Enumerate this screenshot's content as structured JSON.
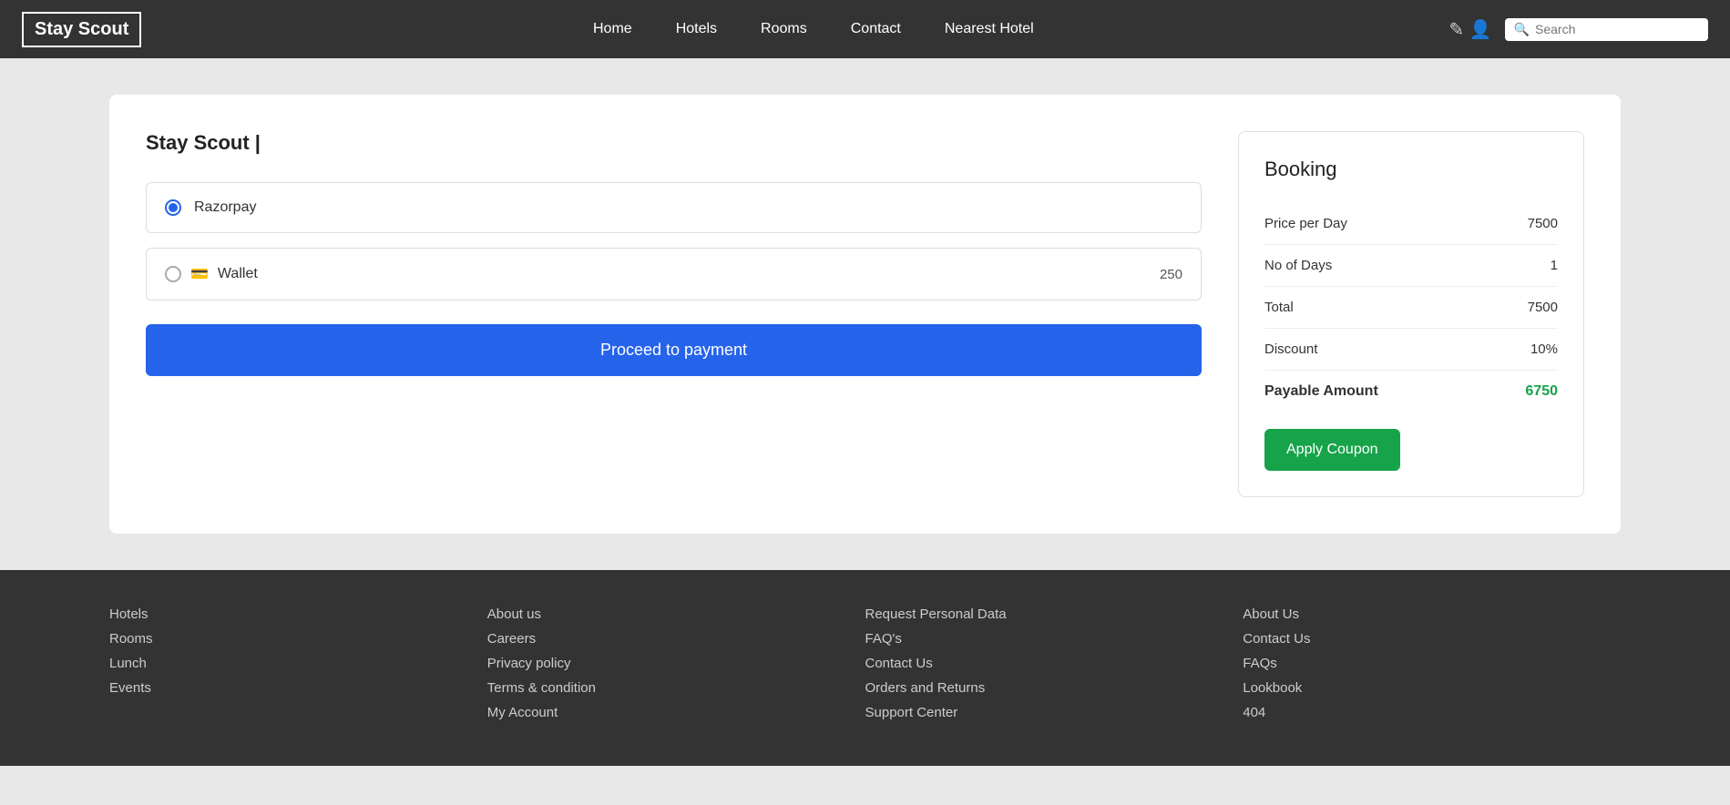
{
  "navbar": {
    "logo": "Stay Scout",
    "links": [
      {
        "label": "Home",
        "name": "home"
      },
      {
        "label": "Hotels",
        "name": "hotels"
      },
      {
        "label": "Rooms",
        "name": "rooms"
      },
      {
        "label": "Contact",
        "name": "contact"
      },
      {
        "label": "Nearest Hotel",
        "name": "nearest-hotel"
      }
    ],
    "search_placeholder": "Search"
  },
  "left_panel": {
    "title": "Stay Scout |",
    "razorpay_label": "Razorpay",
    "wallet_label": "Wallet",
    "wallet_balance": "250",
    "proceed_label": "Proceed to payment"
  },
  "booking": {
    "title": "Booking",
    "price_per_day_label": "Price per Day",
    "price_per_day_value": "7500",
    "no_of_days_label": "No of Days",
    "no_of_days_value": "1",
    "total_label": "Total",
    "total_value": "7500",
    "discount_label": "Discount",
    "discount_value": "10%",
    "payable_label": "Payable Amount",
    "payable_value": "6750",
    "coupon_label": "Apply Coupon"
  },
  "footer": {
    "col1": [
      {
        "label": "Hotels"
      },
      {
        "label": "Rooms"
      },
      {
        "label": "Lunch"
      },
      {
        "label": "Events"
      }
    ],
    "col2": [
      {
        "label": "About us"
      },
      {
        "label": "Careers"
      },
      {
        "label": "Privacy policy"
      },
      {
        "label": "Terms & condition"
      },
      {
        "label": "My Account"
      }
    ],
    "col3": [
      {
        "label": "Request Personal Data"
      },
      {
        "label": "FAQ's"
      },
      {
        "label": "Contact Us"
      },
      {
        "label": "Orders and Returns"
      },
      {
        "label": "Support Center"
      }
    ],
    "col4": [
      {
        "label": "About Us"
      },
      {
        "label": "Contact Us"
      },
      {
        "label": "FAQs"
      },
      {
        "label": "Lookbook"
      },
      {
        "label": "404"
      }
    ]
  }
}
